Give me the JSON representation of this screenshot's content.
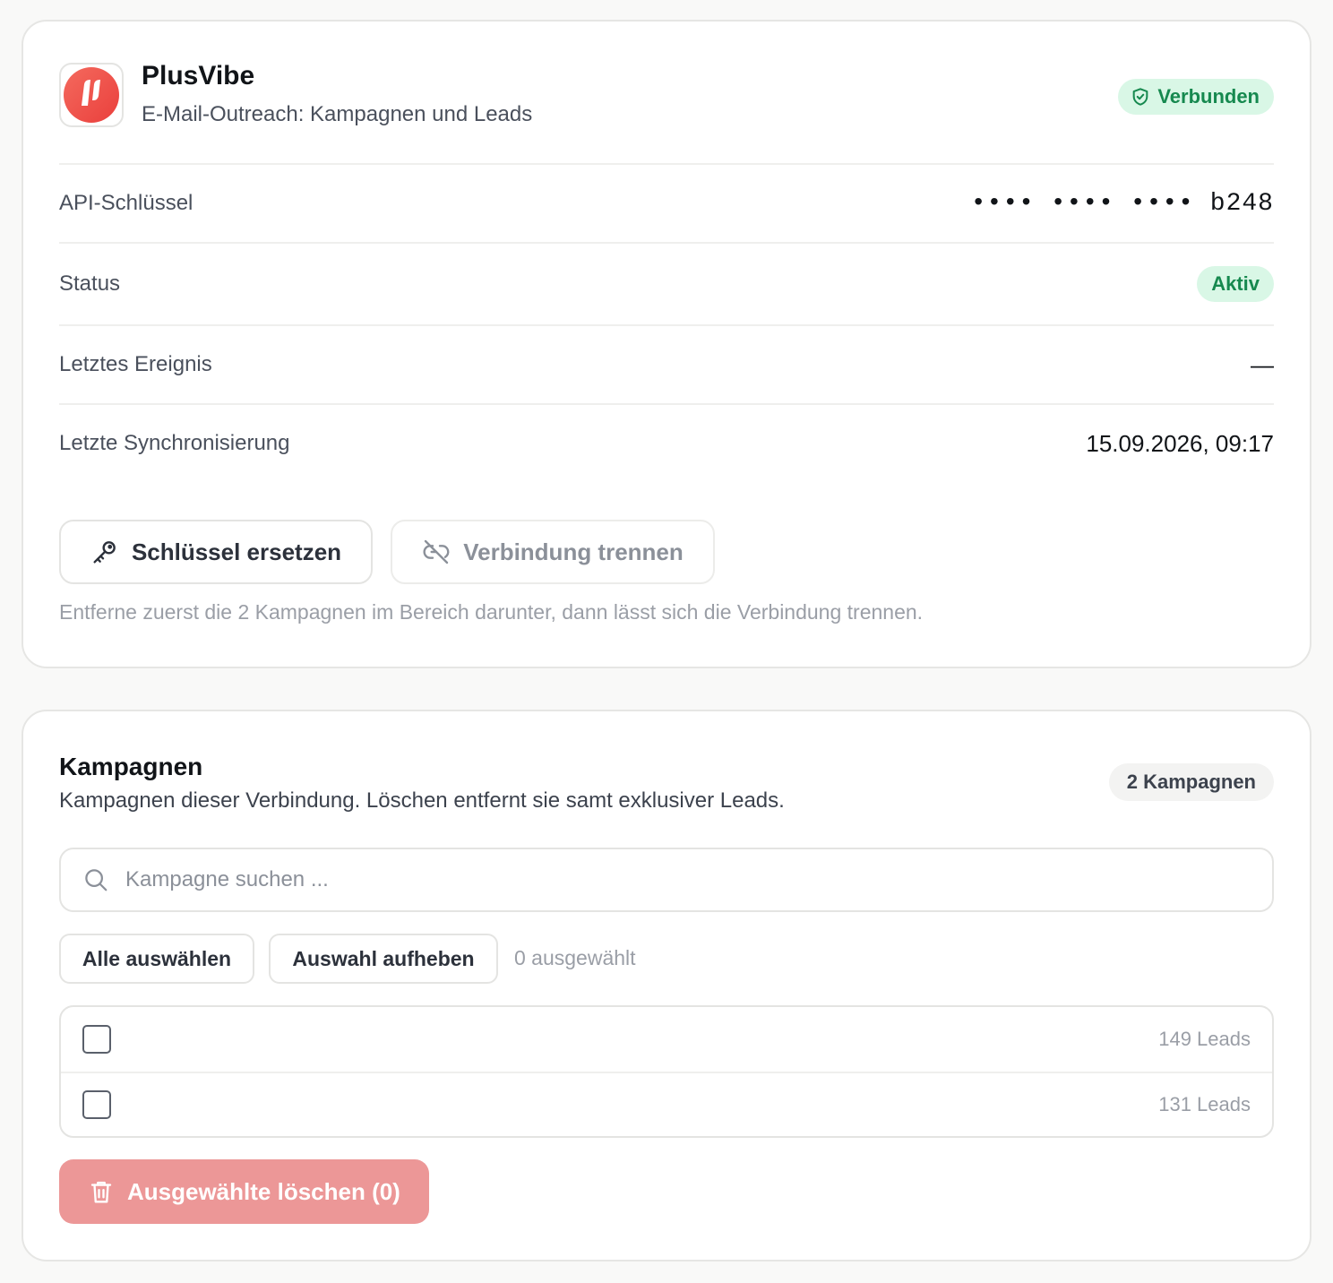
{
  "integration": {
    "name": "PlusVibe",
    "subtitle": "E-Mail-Outreach: Kampagnen und Leads",
    "connection_badge": "Verbunden",
    "logo_color": "#f0504a"
  },
  "details": {
    "api_key_label": "API-Schlüssel",
    "api_key_value": "•••• •••• •••• b248",
    "status_label": "Status",
    "status_value": "Aktiv",
    "last_event_label": "Letztes Ereignis",
    "last_event_value": "—",
    "last_sync_label": "Letzte Synchronisierung",
    "last_sync_value": "15.09.2026, 09:17"
  },
  "actions": {
    "replace_key_label": "Schlüssel ersetzen",
    "replace_key_icon": "key-icon",
    "disconnect_label": "Verbindung trennen",
    "disconnect_icon": "unlink-icon",
    "hint": "Entferne zuerst die 2 Kampagnen im Bereich darunter, dann lässt sich die Verbindung trennen."
  },
  "campaigns": {
    "title": "Kampagnen",
    "description": "Kampagnen dieser Verbindung. Löschen entfernt sie samt exklusiver Leads.",
    "count_badge": "2 Kampagnen",
    "search_placeholder": "Kampagne suchen ...",
    "select_all_label": "Alle auswählen",
    "clear_selection_label": "Auswahl aufheben",
    "selected_count": "0 ausgewählt",
    "items": [
      {
        "name": "",
        "leads": "149 Leads",
        "checked": false
      },
      {
        "name": "",
        "leads": "131 Leads",
        "checked": false
      }
    ],
    "delete_label": "Ausgewählte löschen (0)",
    "delete_icon": "trash-icon"
  },
  "colors": {
    "success_bg": "#d9f7e6",
    "success_text": "#16894f",
    "danger_disabled": "#ec9797"
  }
}
